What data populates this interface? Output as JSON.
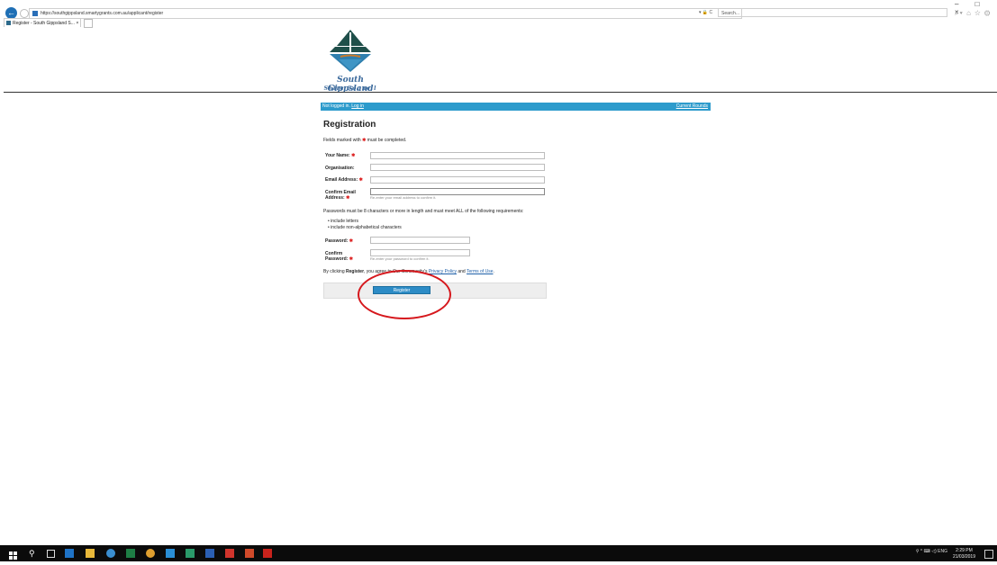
{
  "browser": {
    "url": "https://southgippsland.smartygrants.com.au/applicant/register",
    "search_placeholder": "Search...",
    "tab_title": "Register - South Gippsland S... ×",
    "addr_controls": "▾ 🔒 C",
    "window_controls": "– □ ×",
    "toolbar_icons": "⌕▾ ⌂ ☆ ⚙"
  },
  "logo": {
    "line1": "South Gippsland",
    "line2": "Shire Council"
  },
  "topbar": {
    "status": "Not logged in.",
    "login_link": "Log in",
    "current_rounds": "Current Rounds"
  },
  "form": {
    "title": "Registration",
    "required_note_pre": "Fields marked with",
    "required_note_post": "must be completed.",
    "required_mark": "✱",
    "name_label": "Your Name:",
    "org_label": "Organisation:",
    "email_label": "Email Address:",
    "confirm_email_label_1": "Confirm Email",
    "confirm_email_label_2": "Address:",
    "confirm_email_hint": "Re-enter your email address to confirm it.",
    "password_rules_intro": "Passwords must be 8 characters or more in length and must meet ALL of the following requirements:",
    "password_rules": [
      "include letters",
      "include non-alphabetical characters"
    ],
    "password_label": "Password:",
    "confirm_password_label_1": "Confirm",
    "confirm_password_label_2": "Password:",
    "confirm_password_hint": "Re-enter your password to confirm it.",
    "agree_pre": "By clicking",
    "agree_bold": "Register",
    "agree_mid": ", you agree to Our Community's",
    "privacy_link": "Privacy Policy",
    "agree_and": "and",
    "terms_link": "Terms of Use",
    "agree_end": ".",
    "register_button": "Register"
  },
  "taskbar": {
    "tray": "⚲ ^ ⌨ ◁) ENG",
    "time": "2:29 PM",
    "date": "21/03/2019"
  },
  "colors": {
    "topbar": "#2d9bcc",
    "required": "#dd2222",
    "annotation_circle": "#d6181d",
    "logo_text": "#3c6a9c"
  }
}
